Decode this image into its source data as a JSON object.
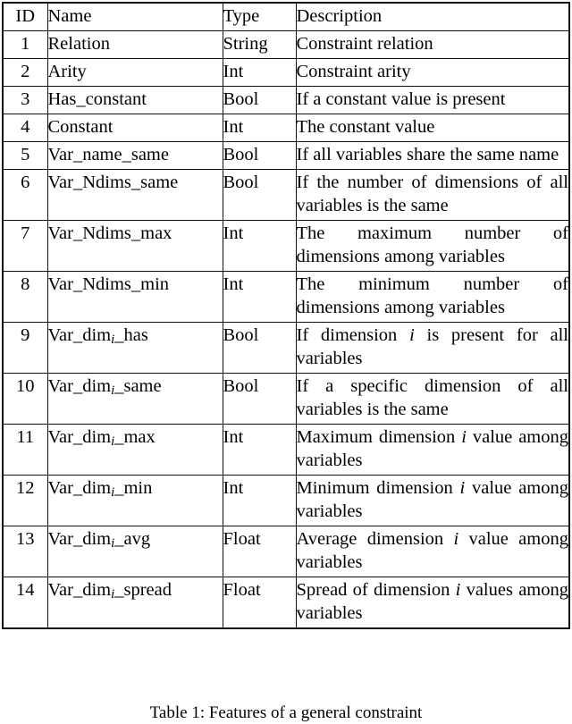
{
  "table": {
    "columns": [
      "ID",
      "Name",
      "Type",
      "Description"
    ],
    "rows": [
      {
        "id": "1",
        "name_pre": "Relation",
        "name_post": "",
        "has_sub": false,
        "type": "String",
        "desc": "Constraint relation",
        "desc_tail": "",
        "lines": 1
      },
      {
        "id": "2",
        "name_pre": "Arity",
        "name_post": "",
        "has_sub": false,
        "type": "Int",
        "desc": "Constraint arity",
        "desc_tail": "",
        "lines": 1
      },
      {
        "id": "3",
        "name_pre": "Has_constant",
        "name_post": "",
        "has_sub": false,
        "type": "Bool",
        "desc": "If a constant value is present",
        "desc_tail": "",
        "lines": 1
      },
      {
        "id": "4",
        "name_pre": "Constant",
        "name_post": "",
        "has_sub": false,
        "type": "Int",
        "desc": "The constant value",
        "desc_tail": "",
        "lines": 1
      },
      {
        "id": "5",
        "name_pre": "Var_name_same",
        "name_post": "",
        "has_sub": false,
        "type": "Bool",
        "desc": "If all variables share the same name",
        "desc_tail": "",
        "lines": 2
      },
      {
        "id": "6",
        "name_pre": "Var_Ndims_same",
        "name_post": "",
        "has_sub": false,
        "type": "Bool",
        "desc": "If the number of dimensions of all variables is the same",
        "desc_tail": "",
        "lines": 2
      },
      {
        "id": "7",
        "name_pre": "Var_Ndims_max",
        "name_post": "",
        "has_sub": false,
        "type": "Int",
        "desc": "The maximum number of dimensions among vari­ables",
        "desc_tail": "",
        "lines": 3
      },
      {
        "id": "8",
        "name_pre": "Var_Ndims_min",
        "name_post": "",
        "has_sub": false,
        "type": "Int",
        "desc": "The minimum number of dimensions among vari­ables",
        "desc_tail": "",
        "lines": 3
      },
      {
        "id": "9",
        "name_pre": "Var_dim",
        "name_post": "_has",
        "has_sub": true,
        "type": "Bool",
        "desc_a": "If dimension ",
        "desc_b": " is present for all variables",
        "lines": 2
      },
      {
        "id": "10",
        "name_pre": "Var_dim",
        "name_post": "_same",
        "has_sub": true,
        "type": "Bool",
        "desc": "If a specific dimension of all variables is the same",
        "desc_tail": "",
        "lines": 2
      },
      {
        "id": "11",
        "name_pre": "Var_dim",
        "name_post": "_max",
        "has_sub": true,
        "type": "Int",
        "desc_a": "Maximum dimension ",
        "desc_b": " value among variables",
        "lines": 2
      },
      {
        "id": "12",
        "name_pre": "Var_dim",
        "name_post": "_min",
        "has_sub": true,
        "type": "Int",
        "desc_a": "Minimum dimension ",
        "desc_b": " value among variables",
        "lines": 2
      },
      {
        "id": "13",
        "name_pre": "Var_dim",
        "name_post": "_avg",
        "has_sub": true,
        "type": "Float",
        "desc_a": "Average dimension ",
        "desc_b": " value among variables",
        "lines": 2
      },
      {
        "id": "14",
        "name_pre": "Var_dim",
        "name_post": "_spread",
        "has_sub": true,
        "type": "Float",
        "desc_a": "Spread of dimension ",
        "desc_b": " val­ues among variables",
        "lines": 2
      }
    ],
    "subscript_symbol": "i"
  },
  "caption": {
    "text": "Table 1: Features of a general constraint"
  }
}
